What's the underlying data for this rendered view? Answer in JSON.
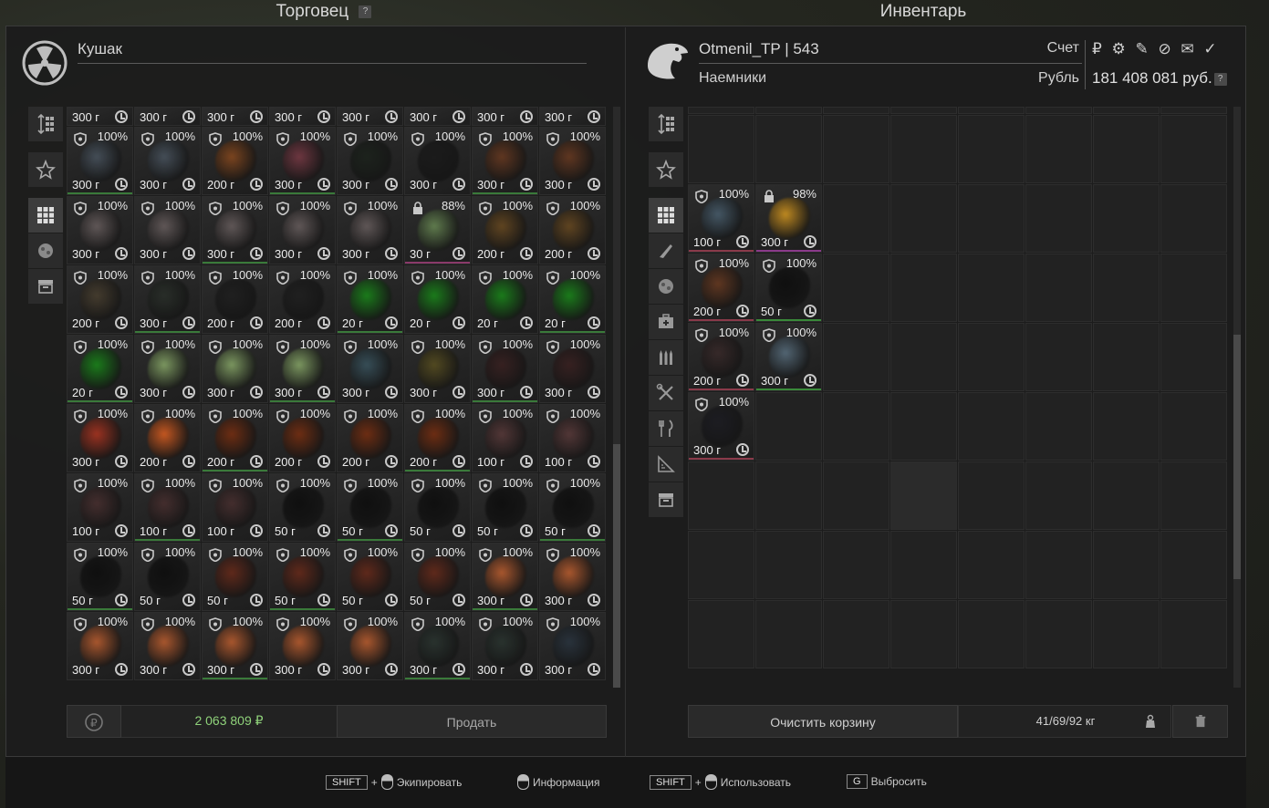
{
  "trader_panel": {
    "title": "Торговец",
    "help": "?",
    "trader_name": "Кушак",
    "total": "2 063 809 ₽",
    "sell_label": "Продать",
    "top_partial_prices": [
      "300 г",
      "300 г",
      "300 г",
      "300 г",
      "300 г",
      "300 г",
      "300 г",
      "300 г"
    ],
    "rows": [
      [
        {
          "d": "100%",
          "p": "300 г",
          "c": "#4a5560"
        },
        {
          "d": "100%",
          "p": "300 г",
          "c": "#4a5560"
        },
        {
          "d": "100%",
          "p": "200 г",
          "c": "#8a4a1e"
        },
        {
          "d": "100%",
          "p": "300 г",
          "c": "#7a3a45"
        },
        {
          "d": "100%",
          "p": "300 г",
          "c": "#1c231c"
        },
        {
          "d": "100%",
          "p": "300 г",
          "c": "#1a1a1a"
        },
        {
          "d": "100%",
          "p": "300 г",
          "c": "#6a3a20"
        },
        {
          "d": "100%",
          "p": "300 г",
          "c": "#6a3a20"
        }
      ],
      [
        {
          "d": "100%",
          "p": "300 г",
          "c": "#6a6060"
        },
        {
          "d": "100%",
          "p": "300 г",
          "c": "#6a6060"
        },
        {
          "d": "100%",
          "p": "300 г",
          "c": "#6a6060"
        },
        {
          "d": "100%",
          "p": "300 г",
          "c": "#6a6060"
        },
        {
          "d": "100%",
          "p": "300 г",
          "c": "#6a6060"
        },
        {
          "d": "88%",
          "p": "30 г",
          "c": "#6a8a55",
          "lock": true
        },
        {
          "d": "100%",
          "p": "200 г",
          "c": "#6a4a20"
        },
        {
          "d": "100%",
          "p": "200 г",
          "c": "#6a4a20"
        }
      ],
      [
        {
          "d": "100%",
          "p": "200 г",
          "c": "#4a4030"
        },
        {
          "d": "100%",
          "p": "300 г",
          "c": "#2a302a"
        },
        {
          "d": "100%",
          "p": "200 г",
          "c": "#1f1f1f"
        },
        {
          "d": "100%",
          "p": "200 г",
          "c": "#1f1f1f"
        },
        {
          "d": "100%",
          "p": "20 г",
          "c": "#1a8a1a"
        },
        {
          "d": "100%",
          "p": "20 г",
          "c": "#1a8a1a"
        },
        {
          "d": "100%",
          "p": "20 г",
          "c": "#1a8a1a"
        },
        {
          "d": "100%",
          "p": "20 г",
          "c": "#1a8a1a"
        }
      ],
      [
        {
          "d": "100%",
          "p": "20 г",
          "c": "#1a8a1a"
        },
        {
          "d": "100%",
          "p": "300 г",
          "c": "#8aaa6a"
        },
        {
          "d": "100%",
          "p": "300 г",
          "c": "#8aaa6a"
        },
        {
          "d": "100%",
          "p": "300 г",
          "c": "#8aaa6a"
        },
        {
          "d": "100%",
          "p": "300 г",
          "c": "#3a5560"
        },
        {
          "d": "100%",
          "p": "300 г",
          "c": "#5a5020"
        },
        {
          "d": "100%",
          "p": "300 г",
          "c": "#3a2020"
        },
        {
          "d": "100%",
          "p": "300 г",
          "c": "#3a2020"
        }
      ],
      [
        {
          "d": "100%",
          "p": "300 г",
          "c": "#b03520"
        },
        {
          "d": "100%",
          "p": "200 г",
          "c": "#e06020"
        },
        {
          "d": "100%",
          "p": "200 г",
          "c": "#7a2f10"
        },
        {
          "d": "100%",
          "p": "200 г",
          "c": "#7a2f10"
        },
        {
          "d": "100%",
          "p": "200 г",
          "c": "#7a2f10"
        },
        {
          "d": "100%",
          "p": "200 г",
          "c": "#7a2f10"
        },
        {
          "d": "100%",
          "p": "100 г",
          "c": "#5a3a3a"
        },
        {
          "d": "100%",
          "p": "100 г",
          "c": "#5a3a3a"
        }
      ],
      [
        {
          "d": "100%",
          "p": "100 г",
          "c": "#4a3030"
        },
        {
          "d": "100%",
          "p": "100 г",
          "c": "#4a3030"
        },
        {
          "d": "100%",
          "p": "100 г",
          "c": "#4a3030"
        },
        {
          "d": "100%",
          "p": "50 г",
          "c": "#0c0c0c"
        },
        {
          "d": "100%",
          "p": "50 г",
          "c": "#0c0c0c"
        },
        {
          "d": "100%",
          "p": "50 г",
          "c": "#0c0c0c"
        },
        {
          "d": "100%",
          "p": "50 г",
          "c": "#0c0c0c"
        },
        {
          "d": "100%",
          "p": "50 г",
          "c": "#0c0c0c"
        }
      ],
      [
        {
          "d": "100%",
          "p": "50 г",
          "c": "#0c0c0c"
        },
        {
          "d": "100%",
          "p": "50 г",
          "c": "#0c0c0c"
        },
        {
          "d": "100%",
          "p": "50 г",
          "c": "#6a2a1a"
        },
        {
          "d": "100%",
          "p": "50 г",
          "c": "#6a2a1a"
        },
        {
          "d": "100%",
          "p": "50 г",
          "c": "#6a2a1a"
        },
        {
          "d": "100%",
          "p": "50 г",
          "c": "#6a2a1a"
        },
        {
          "d": "100%",
          "p": "300 г",
          "c": "#c06030"
        },
        {
          "d": "100%",
          "p": "300 г",
          "c": "#c06030"
        }
      ],
      [
        {
          "d": "100%",
          "p": "300 г",
          "c": "#c06030"
        },
        {
          "d": "100%",
          "p": "300 г",
          "c": "#c06030"
        },
        {
          "d": "100%",
          "p": "300 г",
          "c": "#c06030"
        },
        {
          "d": "100%",
          "p": "300 г",
          "c": "#c06030"
        },
        {
          "d": "100%",
          "p": "300 г",
          "c": "#c06030"
        },
        {
          "d": "100%",
          "p": "300 г",
          "c": "#2a3530"
        },
        {
          "d": "100%",
          "p": "300 г",
          "c": "#2a3530"
        },
        {
          "d": "100%",
          "p": "300 г",
          "c": "#2a3540"
        }
      ]
    ]
  },
  "inventory_panel": {
    "title": "Инвентарь",
    "username": "Otmenil_TP",
    "level_sep": "|",
    "level": "543",
    "group": "Наемники",
    "account_label": "Счет",
    "currency_label": "Рубль",
    "currency_icons": "₽ ⚙ ✎ ⊘ ✉ ✓",
    "amount": "181 408 081 руб.",
    "help": "?",
    "clear_cart_label": "Очистить корзину",
    "weight": "41/69/92 кг",
    "items": [
      {
        "row": 1,
        "col": 0,
        "d": "100%",
        "p": "100 г",
        "c": "#4a6070"
      },
      {
        "row": 1,
        "col": 1,
        "d": "98%",
        "p": "300 г",
        "c": "#d89a20",
        "lock": true
      },
      {
        "row": 2,
        "col": 0,
        "d": "100%",
        "p": "200 г",
        "c": "#6a3a20"
      },
      {
        "row": 2,
        "col": 1,
        "d": "100%",
        "p": "50 г",
        "c": "#0c0c0c"
      },
      {
        "row": 3,
        "col": 0,
        "d": "100%",
        "p": "200 г",
        "c": "#3a2a2a"
      },
      {
        "row": 3,
        "col": 1,
        "d": "100%",
        "p": "300 г",
        "c": "#5a7080"
      },
      {
        "row": 4,
        "col": 0,
        "d": "100%",
        "p": "300 г",
        "c": "#1c1c22"
      }
    ]
  },
  "hints": {
    "shift": "SHIFT",
    "plus": "+",
    "equip": "Экипировать",
    "info": "Информация",
    "use": "Использовать",
    "g_key": "G",
    "drop": "Выбросить"
  },
  "colors": {
    "accent_green": "#8fd27a",
    "border_green": "#3a8a3a",
    "border_red": "#8a3a3a"
  }
}
